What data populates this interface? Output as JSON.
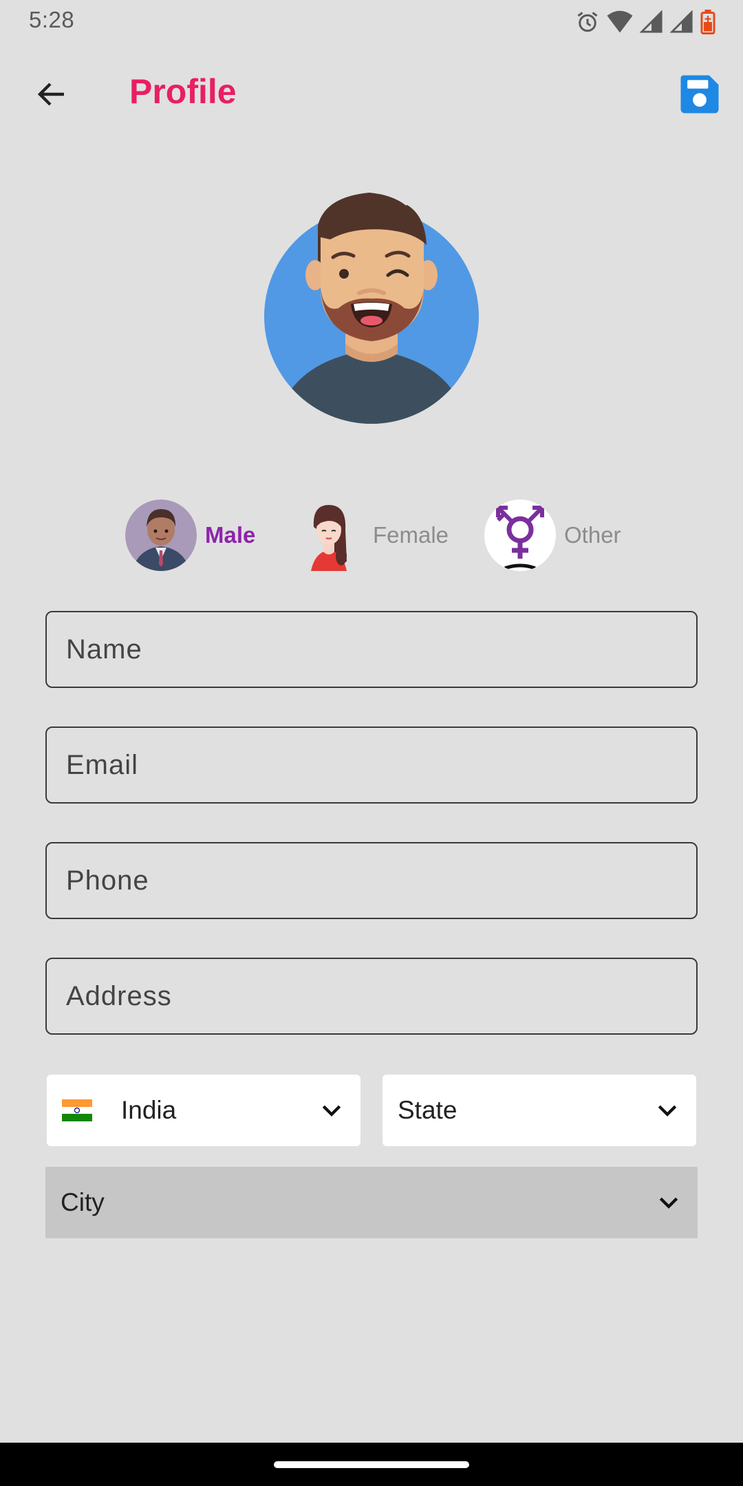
{
  "status_bar": {
    "time": "5:28",
    "icons": [
      "alarm-icon",
      "wifi-icon",
      "signal-icon",
      "signal-icon",
      "battery-icon"
    ]
  },
  "app_bar": {
    "back_icon": "arrow-left-icon",
    "title": "Profile",
    "save_icon": "floppy-disk-icon",
    "title_color": "#e91e63",
    "save_color": "#1e88e5"
  },
  "gender": {
    "options": [
      {
        "label": "Male",
        "selected": true
      },
      {
        "label": "Female",
        "selected": false
      },
      {
        "label": "Other",
        "selected": false
      }
    ],
    "selected_color": "#8e24aa"
  },
  "form": {
    "name_placeholder": "Name",
    "email_placeholder": "Email",
    "phone_placeholder": "Phone",
    "address_placeholder": "Address"
  },
  "location": {
    "country": {
      "value": "India",
      "flag": "india-flag-icon"
    },
    "state": {
      "value": "State"
    },
    "city": {
      "value": "City"
    }
  }
}
